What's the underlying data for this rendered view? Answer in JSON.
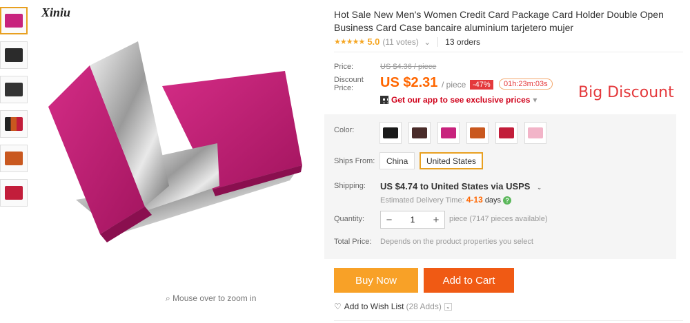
{
  "brand_mark": "Xiniu",
  "zoom_hint": "Mouse over to zoom in",
  "product": {
    "title": "Hot Sale New Men's Women Credit Card Package Card Holder Double Open Business Card Case bancaire aluminium tarjetero mujer",
    "stars": "★★★★★",
    "rating": "5.0",
    "votes": "(11 votes)",
    "orders": "13 orders"
  },
  "price": {
    "price_label": "Price:",
    "old_price": "US $4.36 / piece",
    "discount_label": "Discount Price:",
    "current_price": "US $2.31",
    "per_piece": "/ piece",
    "discount_badge": "-47%",
    "timer": "01h:23m:03s",
    "app_promo": "Get our app to see exclusive prices",
    "promo_note": "Big Discount"
  },
  "options": {
    "color_label": "Color:",
    "colors": [
      "#1a1a1a",
      "#4a2c2a",
      "#c8237d",
      "#c9581f",
      "#c21d3a",
      "#f2b4c8"
    ],
    "ships_from_label": "Ships From:",
    "ships_from": [
      "China",
      "United States"
    ],
    "ships_from_selected": "United States"
  },
  "shipping": {
    "label": "Shipping:",
    "main": "US $4.74 to United States via USPS",
    "est_label": "Estimated Delivery Time:",
    "est_days": "4-13",
    "days_word": "days"
  },
  "quantity": {
    "label": "Quantity:",
    "value": "1",
    "available": "piece (7147 pieces available)"
  },
  "total": {
    "label": "Total Price:",
    "note": "Depends on the product properties you select"
  },
  "actions": {
    "buy_now": "Buy Now",
    "add_to_cart": "Add to Cart",
    "wishlist": "Add to Wish List",
    "wish_count": "(28 Adds)"
  },
  "thumb_colors": [
    "#c8237d",
    "#2b2b2b",
    "#333333",
    "#c9581f",
    "#c9581f",
    "#c21d3a"
  ]
}
